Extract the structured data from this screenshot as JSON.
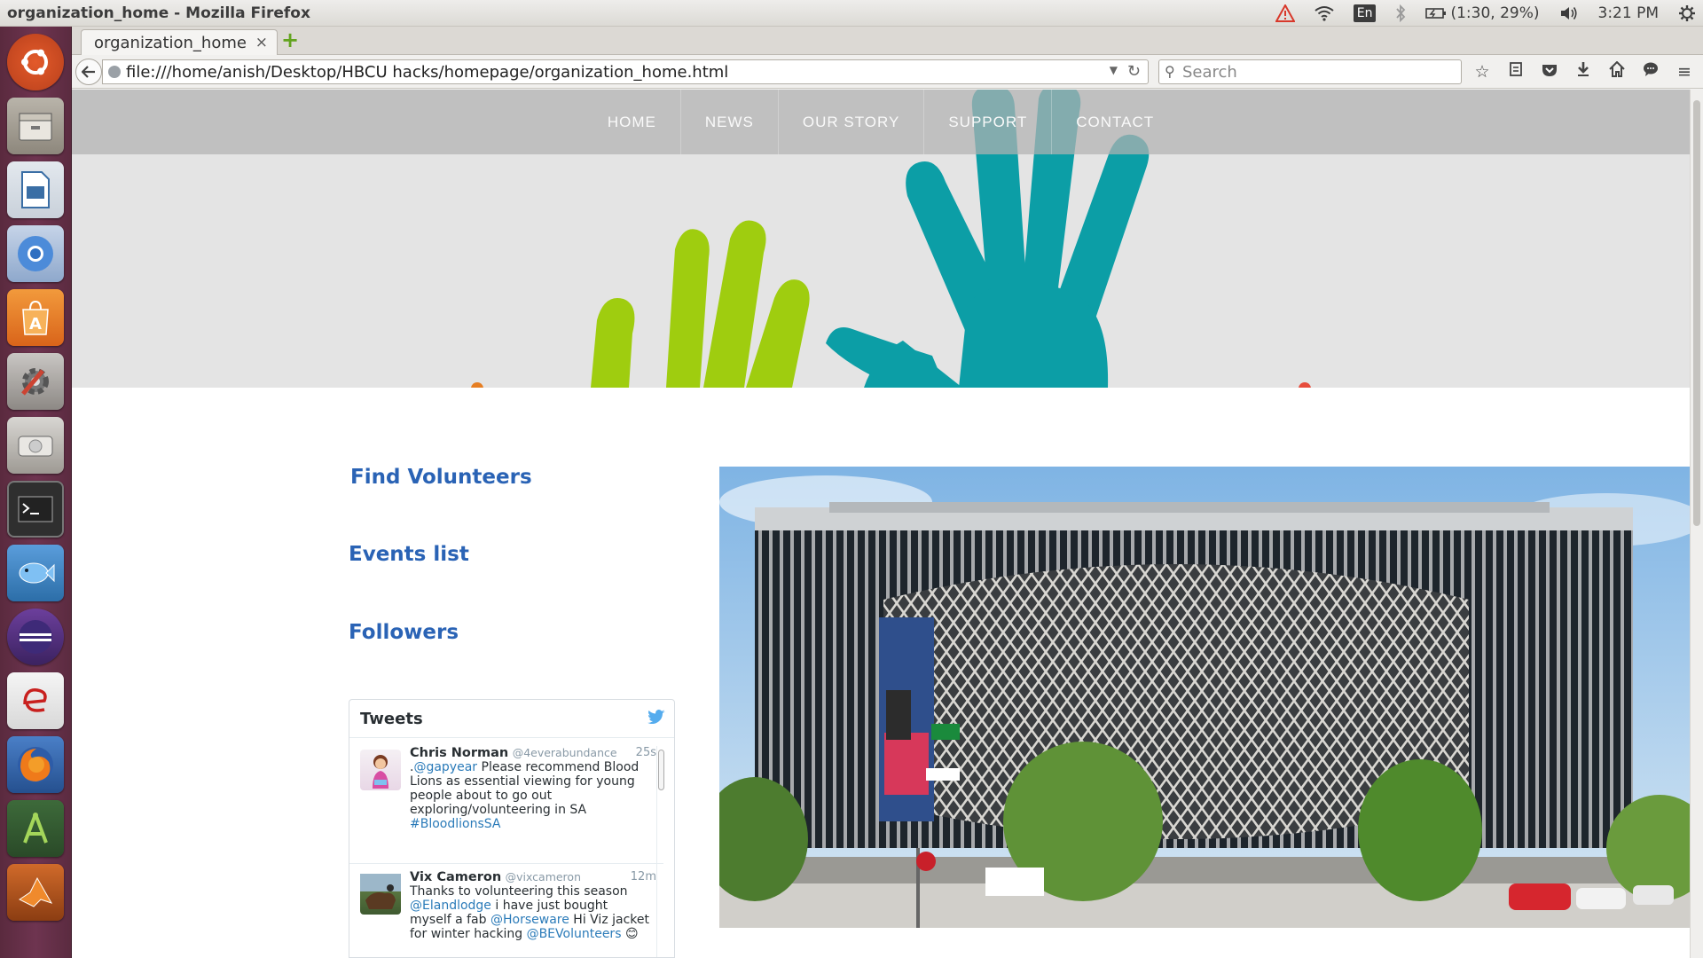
{
  "window": {
    "title": "organization_home - Mozilla Firefox"
  },
  "indicators": {
    "keyboard": "En",
    "battery": "(1:30, 29%)",
    "clock": "3:21 PM"
  },
  "launcher": {
    "items": [
      "ubuntu-dash",
      "files",
      "libreoffice-impress",
      "chromium",
      "software-center",
      "system-settings",
      "disk",
      "terminal",
      "bluefish",
      "eclipse",
      "e-reader",
      "firefox",
      "android-studio",
      "matlab"
    ]
  },
  "browser": {
    "tab_title": "organization_home",
    "tab_close": "×",
    "new_tab": "+",
    "url": "file:///home/anish/Desktop/HBCU hacks/homepage/organization_home.html",
    "search_placeholder": "Search"
  },
  "page": {
    "nav": [
      "HOME",
      "NEWS",
      "OUR STORY",
      "SUPPORT",
      "CONTACT"
    ],
    "links": {
      "find_volunteers": "Find Volunteers",
      "events_list": "Events list",
      "followers": "Followers"
    },
    "tweets": {
      "header": "Tweets",
      "items": [
        {
          "name": "Chris Norman",
          "handle": "@4everabundance",
          "time": "25s",
          "parts": [
            {
              "t": ".",
              "link": false
            },
            {
              "t": "@gapyear",
              "link": true
            },
            {
              "t": " Please recommend Blood Lions as essential viewing for young people about to go out exploring/volunteering in SA ",
              "link": false
            },
            {
              "t": "#BloodlionsSA",
              "link": true
            }
          ]
        },
        {
          "name": "Vix Cameron",
          "handle": "@vixcameron",
          "time": "12m",
          "parts": [
            {
              "t": "Thanks to volunteering this season ",
              "link": false
            },
            {
              "t": "@Elandlodge",
              "link": true
            },
            {
              "t": " i have just bought myself a fab ",
              "link": false
            },
            {
              "t": "@Horseware",
              "link": true
            },
            {
              "t": " Hi Viz jacket for winter hacking ",
              "link": false
            },
            {
              "t": "@BEVolunteers",
              "link": true
            },
            {
              "t": " 😊",
              "link": false
            }
          ]
        }
      ]
    }
  },
  "colors": {
    "link_blue": "#2a63b5",
    "hand_green": "#9fcd0f",
    "hand_teal": "#0c9ea6",
    "twitter_blue": "#55acee"
  }
}
